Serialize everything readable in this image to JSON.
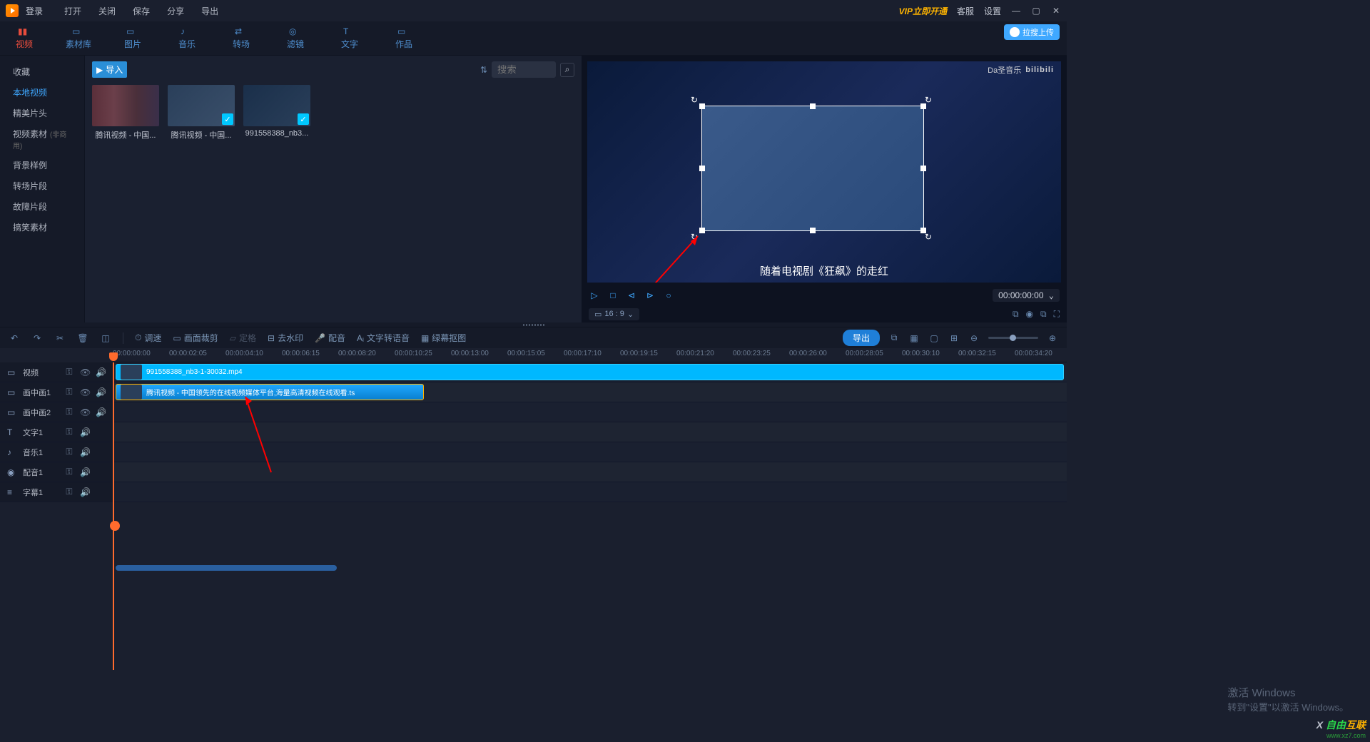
{
  "titlebar": {
    "login": "登录",
    "menus": [
      "打开",
      "关闭",
      "保存",
      "分享",
      "导出"
    ],
    "vip": "VIP立即开通",
    "service": "客服",
    "settings": "设置"
  },
  "upload_pill": "拉搜上传",
  "tabs": [
    {
      "label": "视频",
      "active": true
    },
    {
      "label": "素材库"
    },
    {
      "label": "图片"
    },
    {
      "label": "音乐"
    },
    {
      "label": "转场"
    },
    {
      "label": "滤镜"
    },
    {
      "label": "文字"
    },
    {
      "label": "作品"
    }
  ],
  "sidebar": [
    {
      "label": "收藏"
    },
    {
      "label": "本地视频",
      "active": true
    },
    {
      "label": "精美片头"
    },
    {
      "label": "视频素材",
      "tag": "(非商用)"
    },
    {
      "label": "背景样例"
    },
    {
      "label": "转场片段"
    },
    {
      "label": "故障片段"
    },
    {
      "label": "搞笑素材"
    }
  ],
  "media_head": {
    "import": "导入",
    "search_placeholder": "搜索"
  },
  "media_items": [
    {
      "name": "腾讯视频 - 中国..."
    },
    {
      "name": "腾讯视频 - 中国...",
      "checked": true
    },
    {
      "name": "991558388_nb3...",
      "checked": true
    }
  ],
  "preview": {
    "watermark": "Da圣音乐",
    "logo": "bilibili",
    "caption": "随着电视剧《狂飙》的走红",
    "time": "00:00:00:00",
    "ratio": "16 : 9"
  },
  "editrow": {
    "opts": [
      "调速",
      "画面裁剪",
      "定格",
      "去水印",
      "配音",
      "文字转语音",
      "绿幕抠图"
    ],
    "export": "导出"
  },
  "ruler_ticks": [
    "00:00:00:00",
    "00:00:02:05",
    "00:00:04:10",
    "00:00:06:15",
    "00:00:08:20",
    "00:00:10:25",
    "00:00:13:00",
    "00:00:15:05",
    "00:00:17:10",
    "00:00:19:15",
    "00:00:21:20",
    "00:00:23:25",
    "00:00:26:00",
    "00:00:28:05",
    "00:00:30:10",
    "00:00:32:15",
    "00:00:34:20"
  ],
  "tracks": [
    {
      "name": "视频",
      "icon": "▭"
    },
    {
      "name": "画中画1",
      "icon": "▭"
    },
    {
      "name": "画中画2",
      "icon": "▭"
    },
    {
      "name": "文字1",
      "icon": "T"
    },
    {
      "name": "音乐1",
      "icon": "♪"
    },
    {
      "name": "配音1",
      "icon": "◉"
    },
    {
      "name": "字幕1",
      "icon": "≡"
    }
  ],
  "clips": {
    "video": "991558388_nb3-1-30032.mp4",
    "pip": "腾讯视频 - 中国领先的在线视频媒体平台,海量高清视频在线观看.ts"
  },
  "winmark": {
    "l1": "激活 Windows",
    "l2": "转到\"设置\"以激活 Windows。"
  },
  "brand": {
    "t1": "自由",
    "t2": "互联",
    "url": "www.xz7.com"
  }
}
